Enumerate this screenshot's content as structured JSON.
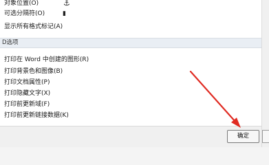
{
  "display_options": [
    {
      "label": "对象位置(O)",
      "icon": "anchor-icon",
      "glyph": "⚓"
    },
    {
      "label": "可选分隔符(O)",
      "icon": "optional-hyphen-icon",
      "glyph": "▮"
    },
    {
      "label": "显示所有格式标记(A)"
    }
  ],
  "section": {
    "title": "D选项"
  },
  "print_options": [
    "打印在 Word 中创建的图形(R)",
    "打印背景色和图像(B)",
    "打印文档属性(P)",
    "打印隐藏文字(X)",
    "打印前更新域(F)",
    "打印前更新链接数据(K)"
  ],
  "buttons": {
    "ok": "确定"
  },
  "colors": {
    "arrow": "#e02b22",
    "section_bg": "#e9eef4"
  }
}
